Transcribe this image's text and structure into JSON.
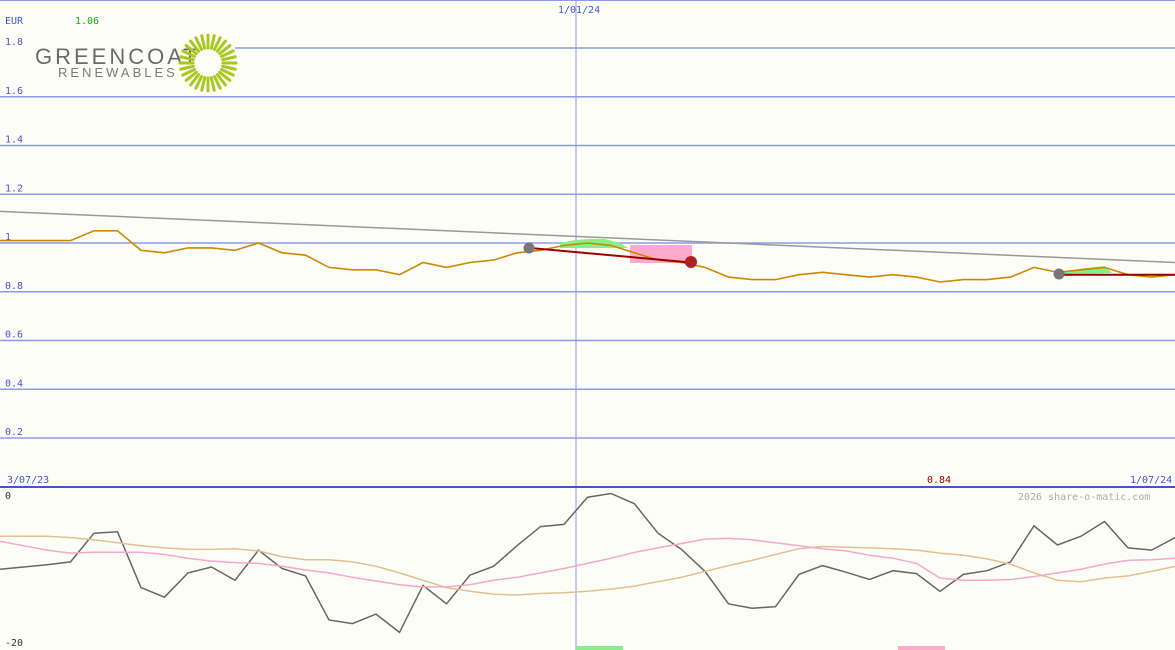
{
  "header": {
    "currency": "EUR",
    "last_price": "1.06"
  },
  "logo": {
    "line1": "GREENCOAT",
    "line2": "RENEWABLES"
  },
  "markers": {
    "mid_date": "1/01/24",
    "start_date": "3/07/23",
    "end_date": "1/07/24",
    "low_value": "0.84"
  },
  "copyright": "2026 share-o-matic.com",
  "colors": {
    "price": "#cc8800",
    "grid": "#8b9be6",
    "trend": "#999999",
    "signal": "#990000",
    "gain": "#88ee88",
    "loss": "#ffaacc"
  },
  "chart_data": [
    {
      "type": "line",
      "panel": "price",
      "y_ticks": [
        "1.8",
        "1.6",
        "1.4",
        "1.2",
        "1",
        "0.8",
        "0.6",
        "0.4",
        "0.2"
      ],
      "ylim": [
        0,
        2
      ],
      "x_range": [
        "3/07/23",
        "1/07/24"
      ],
      "series": [
        {
          "values": [
            1.01,
            1.01,
            1.01,
            1.01,
            1.05,
            1.05,
            0.97,
            0.96,
            0.98,
            0.98,
            0.97,
            1.0,
            0.96,
            0.95,
            0.9,
            0.89,
            0.89,
            0.87,
            0.92,
            0.9,
            0.92,
            0.93,
            0.96,
            0.97,
            0.99,
            1.0,
            0.99,
            0.96,
            0.93,
            0.92,
            0.9,
            0.86,
            0.85,
            0.85,
            0.87,
            0.88,
            0.87,
            0.86,
            0.87,
            0.86,
            0.84,
            0.85,
            0.85,
            0.86,
            0.9,
            0.88,
            0.89,
            0.9,
            0.87,
            0.86,
            0.87
          ]
        },
        {
          "values": [
            1.13,
            0.92
          ]
        },
        {
          "values": [
            0.98,
            0.92
          ]
        },
        {
          "values": [
            0.87,
            0.87
          ]
        }
      ]
    },
    {
      "type": "line",
      "panel": "indicator",
      "y_ticks": [
        "0",
        "-20"
      ],
      "ylim": [
        -20,
        0
      ],
      "series": [
        {
          "values": [
            -10.1,
            -9.8,
            -9.5,
            -9.1,
            -5.2,
            -5.0,
            -12.6,
            -13.9,
            -10.6,
            -9.8,
            -11.6,
            -7.5,
            -10.0,
            -11.0,
            -17.0,
            -17.5,
            -16.2,
            -18.7,
            -12.3,
            -14.8,
            -10.9,
            -9.7,
            -6.9,
            -4.3,
            -4.0,
            -0.3,
            0.2,
            -1.2,
            -5.2,
            -7.4,
            -10.4,
            -14.8,
            -15.4,
            -15.2,
            -10.8,
            -9.6,
            -10.5,
            -11.5,
            -10.3,
            -10.7,
            -13.1,
            -10.8,
            -10.3,
            -9.1,
            -4.2,
            -6.8,
            -5.6,
            -3.6,
            -7.2,
            -7.5,
            -5.8
          ]
        },
        {
          "values": [
            -5.6,
            -5.6,
            -5.6,
            -5.8,
            -6.1,
            -6.5,
            -6.9,
            -7.2,
            -7.4,
            -7.4,
            -7.3,
            -7.6,
            -8.4,
            -8.8,
            -8.8,
            -9.1,
            -9.7,
            -10.6,
            -11.6,
            -12.6,
            -13.1,
            -13.5,
            -13.6,
            -13.4,
            -13.3,
            -13.1,
            -12.8,
            -12.4,
            -11.8,
            -11.2,
            -10.4,
            -9.6,
            -8.9,
            -8.1,
            -7.3,
            -7.0,
            -7.1,
            -7.2,
            -7.3,
            -7.5,
            -7.9,
            -8.2,
            -8.7,
            -9.4,
            -10.6,
            -11.6,
            -11.8,
            -11.3,
            -11.0,
            -10.4,
            -9.7
          ]
        },
        {
          "values": [
            -6.3,
            -6.9,
            -7.5,
            -7.9,
            -7.8,
            -7.8,
            -7.8,
            -8.1,
            -8.6,
            -9.0,
            -9.2,
            -9.3,
            -9.7,
            -10.2,
            -10.6,
            -11.2,
            -11.7,
            -12.2,
            -12.5,
            -12.5,
            -12.2,
            -11.6,
            -11.2,
            -10.6,
            -10.0,
            -9.3,
            -8.6,
            -7.8,
            -7.2,
            -6.6,
            -6.0,
            -5.9,
            -6.1,
            -6.5,
            -6.9,
            -7.3,
            -7.6,
            -8.2,
            -8.6,
            -9.3,
            -11.3,
            -11.6,
            -11.6,
            -11.5,
            -11.1,
            -10.6,
            -10.1,
            -9.4,
            -8.9,
            -8.8,
            -8.6
          ]
        }
      ]
    }
  ]
}
